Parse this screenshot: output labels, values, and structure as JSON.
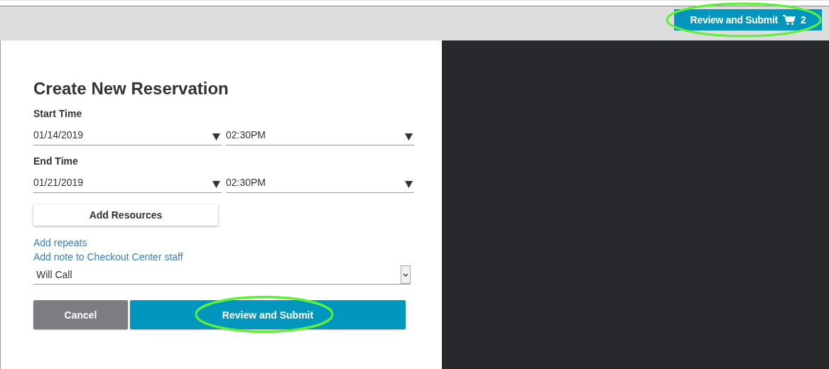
{
  "top_bar": {
    "submit_button": {
      "label": "Review and Submit",
      "cart_count": "2",
      "highlighted": true
    }
  },
  "form": {
    "title": "Create New Reservation",
    "time_groups": [
      {
        "label": "Start Time",
        "date": "01/14/2019",
        "time": "02:30PM"
      },
      {
        "label": "End Time",
        "date": "01/21/2019",
        "time": "02:30PM"
      }
    ],
    "add_resources_button": "Add Resources",
    "links": [
      "Add repeats",
      "Add note to Checkout Center staff"
    ],
    "delivery_select": "Will Call",
    "buttons": [
      {
        "label": "Cancel",
        "kind": "secondary",
        "highlighted": false
      },
      {
        "label": "Review and Submit",
        "kind": "primary",
        "highlighted": true
      }
    ]
  }
}
